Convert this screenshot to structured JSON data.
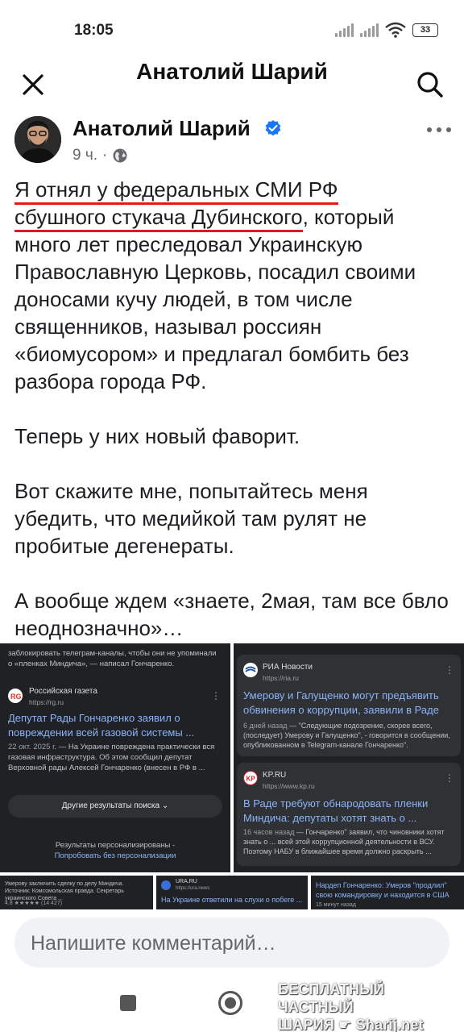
{
  "status_bar": {
    "time": "18:05",
    "battery": "33",
    "icons": [
      "signal-icon",
      "signal-icon",
      "wifi-icon",
      "battery-icon"
    ]
  },
  "header": {
    "title": "Анатолий Шарий",
    "close_icon": "close-icon",
    "search_icon": "search-icon"
  },
  "post": {
    "author": "Анатолий Шарий",
    "time": "9 ч.",
    "separator": "·",
    "paragraphs": [
      "много лет преследовал Украинскую Православную Церковь, посадил своими доносами кучу людей, в том числе священников, называл россиян «биомусором» и предлагал бомбить без разбора города РФ.",
      "Теперь у них новый фаворит.",
      "Вот скажите мне, попытайтесь меня убедить, что медийкой там рулят не пробитые дегенераты.",
      "А вообще ждем «знаете, 2мая, там все бвло неоднозначно»…"
    ],
    "underlined_line1": "Я отнял у федеральных СМИ РФ",
    "underlined_line2": "сбушного стукача Дубинского",
    "line2_rest": ", который"
  },
  "collage": {
    "left": {
      "top_snippet": "заблокировать телеграм-каналы, чтобы они не упоминали о «пленках Миндича», — написал Гончаренко.",
      "source_name": "Российская газета",
      "source_url": "https://rg.ru",
      "title": "Депутат Рады Гончаренко заявил о повреждении всей газовой системы ...",
      "date": "22 окт. 2025 г.",
      "snippet": " — На Украине повреждена практически вся газовая инфраструктура. Об этом сообщил депутат Верховной рады Алексей Гончаренко (внесен в РФ в ...",
      "more_results": "Другие результаты поиска",
      "personalized": "Результаты персонализированы -",
      "try_without": "Попробовать без персонализации"
    },
    "right": {
      "card1": {
        "source_name": "РИА Новости",
        "source_url": "https://ria.ru",
        "title": "Умерову и Галущенко могут предъявить обвинения о коррупции, заявили в Раде",
        "date": "6 дней назад",
        "snippet": " — \"Следующие подозрение, скорее всего, (последует) Умерову и Галущенко\", - говорится в сообщении, опубликованном в Telegram-канале Гончаренко\"."
      },
      "card2": {
        "source_name": "KP.RU",
        "source_url": "https://www.kp.ru",
        "title": "В Раде требуют обнародовать пленки Миндича: депутаты хотят знать о ...",
        "date": "16 часов назад",
        "snippet": " — Гончаренко\" заявил, что чиновники хотят знать о ... всей этой коррупционной деятельности в ВСУ. Поэтому НАБУ в ближайшее время должно раскрыть ..."
      }
    },
    "strip": {
      "s1": "Умерову заключить сделку по делу Миндича. Источник: Комсомольская правда. Секретарь украинского Совета ...",
      "s1_rating": "4.8 ★★★★★ (14 427)",
      "s2_source": "URA.RU",
      "s2_url": "https://ura.news",
      "s2_title": "На Украине ответили на слухи о побеге ...",
      "s3_title": "Нардеп Гончаренко: Умеров \"продлил\" свою командировку и находится в США",
      "s3_date": "15 минут назад"
    }
  },
  "comment": {
    "placeholder": "Напишите комментарий…"
  },
  "watermark": {
    "line1": "БЕСПЛАТНЫЙ ЧАСТНЫЙ",
    "line2": "ШАРИЯ ☛ Sharij.net"
  }
}
